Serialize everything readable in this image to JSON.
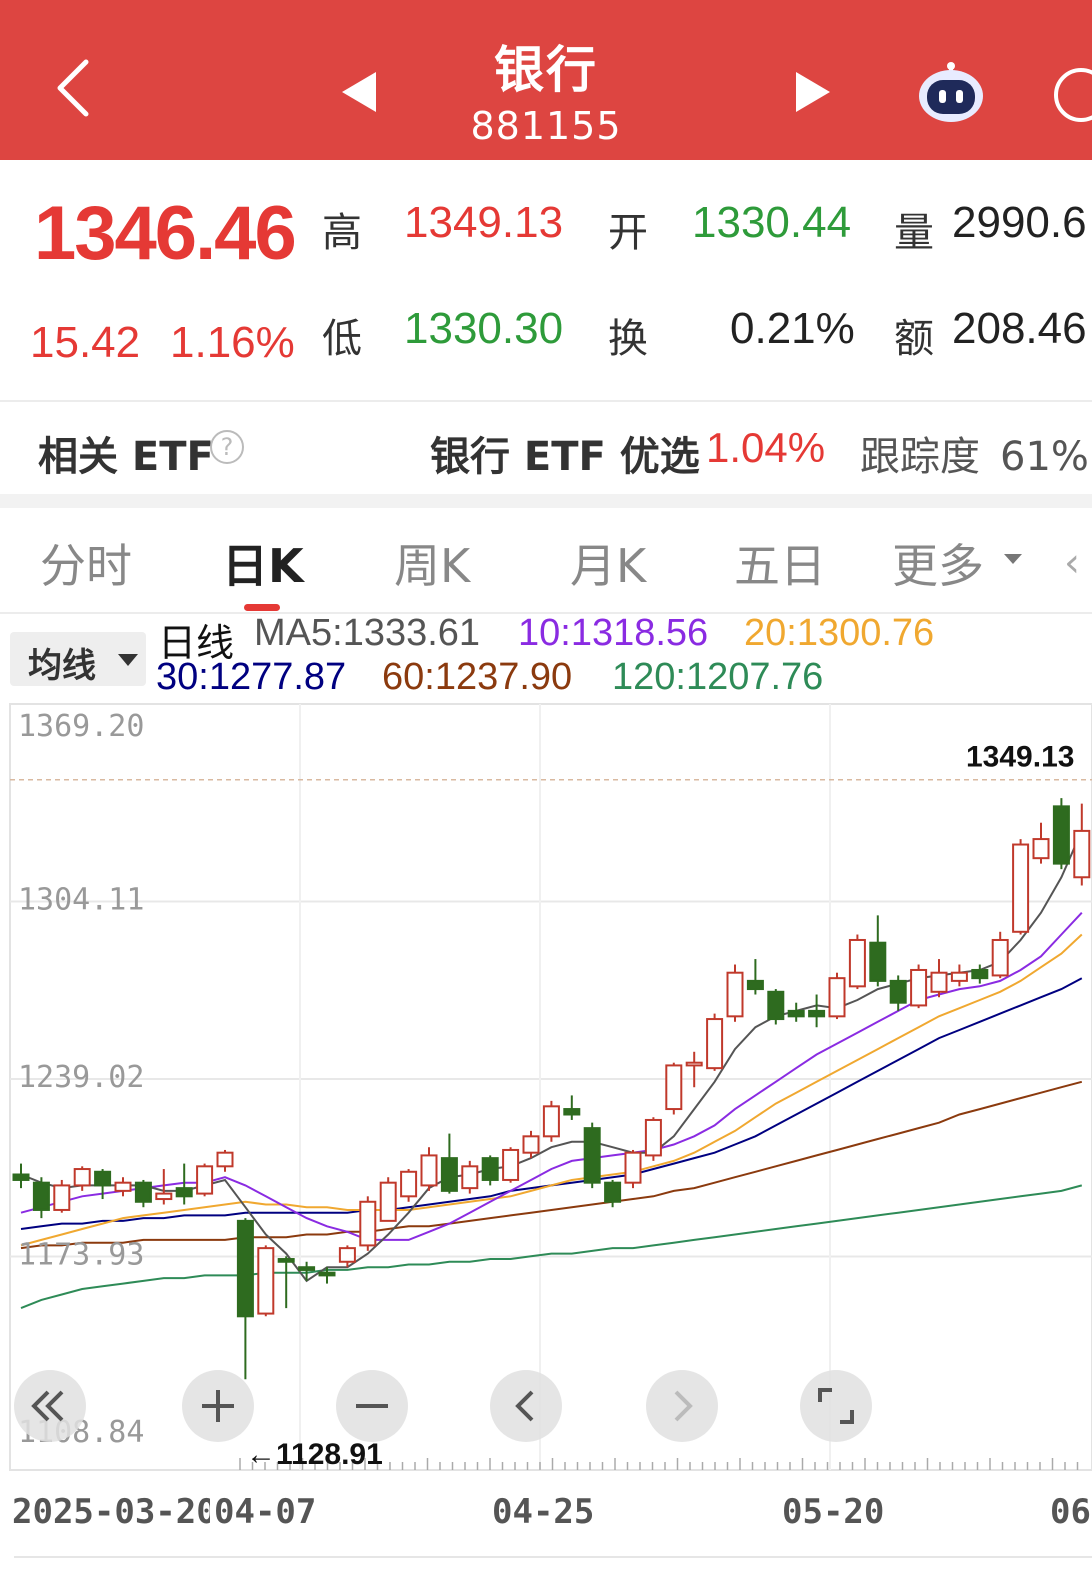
{
  "header": {
    "title": "银行",
    "code": "881155",
    "bg_color": "#dd4541"
  },
  "quote": {
    "price": "1346.46",
    "change": "15.42",
    "change_pct": "1.16%",
    "high_label": "高",
    "high": "1349.13",
    "open_label": "开",
    "open": "1330.44",
    "volume_label": "量",
    "volume": "2990.6",
    "low_label": "低",
    "low": "1330.30",
    "turnover_label": "换",
    "turnover": "0.21%",
    "amount_label": "额",
    "amount": "208.46"
  },
  "etf": {
    "label": "相关 ETF",
    "help_icon": "?",
    "name": "银行 ETF 优选",
    "pct": "1.04%",
    "track_label": "跟踪度",
    "track_value": "61%"
  },
  "tabs": [
    {
      "label": "分时"
    },
    {
      "label": "日K"
    },
    {
      "label": "周K"
    },
    {
      "label": "月K"
    },
    {
      "label": "五日"
    },
    {
      "label": "更多"
    }
  ],
  "ma_bar": {
    "button": "均线",
    "period": "日线",
    "ma5": "MA5:1333.61",
    "ma10": "10:1318.56",
    "ma20": "20:1300.76",
    "ma30": "30:1277.87",
    "ma60": "60:1237.90",
    "ma120": "120:1207.76",
    "colors": {
      "ma5": "#555555",
      "ma10": "#8a2be2",
      "ma20": "#f0a830",
      "ma30": "#000080",
      "ma60": "#8b3a0e",
      "ma120": "#2e8b57"
    }
  },
  "chart_data": {
    "type": "candlestick",
    "y_ticks": [
      "1369.20",
      "1304.11",
      "1239.02",
      "1173.93",
      "1108.84"
    ],
    "ylim": [
      1108.84,
      1369.2
    ],
    "x_labels": [
      "2025-03-20",
      "04-07",
      "04-25",
      "05-20",
      "06"
    ],
    "max_label": "1349.13",
    "min_label": "←1128.91",
    "up_color": "#c0392b",
    "down_color": "#2e6b1f",
    "candles": [
      {
        "o": 1204,
        "c": 1202,
        "h": 1208,
        "l": 1199
      },
      {
        "o": 1201,
        "c": 1191,
        "h": 1203,
        "l": 1188
      },
      {
        "o": 1191,
        "c": 1200,
        "h": 1202,
        "l": 1190
      },
      {
        "o": 1200,
        "c": 1206,
        "h": 1207,
        "l": 1198
      },
      {
        "o": 1205,
        "c": 1200,
        "h": 1206,
        "l": 1195
      },
      {
        "o": 1198,
        "c": 1201,
        "h": 1203,
        "l": 1196
      },
      {
        "o": 1201,
        "c": 1194,
        "h": 1202,
        "l": 1192
      },
      {
        "o": 1195,
        "c": 1197,
        "h": 1206,
        "l": 1193
      },
      {
        "o": 1199,
        "c": 1196,
        "h": 1208,
        "l": 1193
      },
      {
        "o": 1197,
        "c": 1207,
        "h": 1208,
        "l": 1196
      },
      {
        "o": 1207,
        "c": 1212,
        "h": 1213,
        "l": 1205
      },
      {
        "o": 1187,
        "c": 1152,
        "h": 1188,
        "l": 1128.91
      },
      {
        "o": 1153,
        "c": 1177,
        "h": 1178,
        "l": 1152
      },
      {
        "o": 1173,
        "c": 1172,
        "h": 1174,
        "l": 1155
      },
      {
        "o": 1170,
        "c": 1169,
        "h": 1172,
        "l": 1165
      },
      {
        "o": 1168,
        "c": 1167,
        "h": 1170,
        "l": 1164
      },
      {
        "o": 1172,
        "c": 1177,
        "h": 1178,
        "l": 1170
      },
      {
        "o": 1178,
        "c": 1194,
        "h": 1196,
        "l": 1176
      },
      {
        "o": 1187,
        "c": 1201,
        "h": 1203,
        "l": 1187
      },
      {
        "o": 1196,
        "c": 1205,
        "h": 1206,
        "l": 1194
      },
      {
        "o": 1200,
        "c": 1211,
        "h": 1214,
        "l": 1198
      },
      {
        "o": 1210,
        "c": 1198,
        "h": 1219,
        "l": 1197
      },
      {
        "o": 1199,
        "c": 1207,
        "h": 1209,
        "l": 1197
      },
      {
        "o": 1210,
        "c": 1202,
        "h": 1211,
        "l": 1200
      },
      {
        "o": 1202,
        "c": 1213,
        "h": 1214,
        "l": 1201
      },
      {
        "o": 1212,
        "c": 1218,
        "h": 1220,
        "l": 1210
      },
      {
        "o": 1218,
        "c": 1229,
        "h": 1231,
        "l": 1216
      },
      {
        "o": 1228,
        "c": 1226,
        "h": 1233,
        "l": 1224
      },
      {
        "o": 1221,
        "c": 1201,
        "h": 1223,
        "l": 1199
      },
      {
        "o": 1201,
        "c": 1194,
        "h": 1202,
        "l": 1192
      },
      {
        "o": 1201,
        "c": 1212,
        "h": 1213,
        "l": 1199
      },
      {
        "o": 1211,
        "c": 1224,
        "h": 1225,
        "l": 1209
      },
      {
        "o": 1228,
        "c": 1244,
        "h": 1245,
        "l": 1226
      },
      {
        "o": 1244,
        "c": 1245,
        "h": 1249,
        "l": 1236
      },
      {
        "o": 1243,
        "c": 1261,
        "h": 1263,
        "l": 1242
      },
      {
        "o": 1262,
        "c": 1278,
        "h": 1281,
        "l": 1260
      },
      {
        "o": 1275,
        "c": 1272,
        "h": 1283,
        "l": 1270
      },
      {
        "o": 1271,
        "c": 1261,
        "h": 1272,
        "l": 1259
      },
      {
        "o": 1264,
        "c": 1262,
        "h": 1267,
        "l": 1260
      },
      {
        "o": 1264,
        "c": 1262,
        "h": 1270,
        "l": 1258
      },
      {
        "o": 1262,
        "c": 1276,
        "h": 1278,
        "l": 1261
      },
      {
        "o": 1273,
        "c": 1290,
        "h": 1292,
        "l": 1272
      },
      {
        "o": 1289,
        "c": 1275,
        "h": 1299,
        "l": 1273
      },
      {
        "o": 1275,
        "c": 1267,
        "h": 1277,
        "l": 1264
      },
      {
        "o": 1266,
        "c": 1279,
        "h": 1281,
        "l": 1265
      },
      {
        "o": 1271,
        "c": 1278,
        "h": 1283,
        "l": 1269
      },
      {
        "o": 1275,
        "c": 1278,
        "h": 1281,
        "l": 1273
      },
      {
        "o": 1279,
        "c": 1276,
        "h": 1281,
        "l": 1274
      },
      {
        "o": 1277,
        "c": 1290,
        "h": 1293,
        "l": 1276
      },
      {
        "o": 1293,
        "c": 1325,
        "h": 1327,
        "l": 1292
      },
      {
        "o": 1320,
        "c": 1327,
        "h": 1333,
        "l": 1318
      },
      {
        "o": 1339,
        "c": 1318,
        "h": 1342,
        "l": 1316
      },
      {
        "o": 1313,
        "c": 1330,
        "h": 1340,
        "l": 1310
      }
    ],
    "ma5": [
      1204,
      1201,
      1199,
      1200,
      1200,
      1200,
      1200,
      1198,
      1198,
      1200,
      1202,
      1192,
      1182,
      1175,
      1165,
      1170,
      1170,
      1175,
      1182,
      1190,
      1199,
      1203,
      1204,
      1206,
      1207,
      1210,
      1214,
      1216,
      1216,
      1214,
      1212,
      1212,
      1218,
      1228,
      1238,
      1250,
      1258,
      1262,
      1264,
      1266,
      1265,
      1268,
      1272,
      1274,
      1276,
      1277,
      1278,
      1279,
      1282,
      1290,
      1300,
      1313,
      1330
    ],
    "ma10": [
      1190,
      1192,
      1194,
      1196,
      1197,
      1198,
      1199,
      1200,
      1201,
      1201,
      1203,
      1200,
      1196,
      1192,
      1188,
      1185,
      1183,
      1180,
      1180,
      1180,
      1183,
      1186,
      1190,
      1194,
      1198,
      1202,
      1206,
      1209,
      1210,
      1211,
      1212,
      1213,
      1215,
      1218,
      1222,
      1228,
      1233,
      1238,
      1243,
      1248,
      1252,
      1256,
      1260,
      1264,
      1268,
      1270,
      1272,
      1273,
      1275,
      1279,
      1284,
      1292,
      1300
    ],
    "ma20": [
      1178,
      1180,
      1182,
      1184,
      1186,
      1188,
      1189,
      1190,
      1191,
      1192,
      1193,
      1194,
      1193,
      1193,
      1192,
      1192,
      1191,
      1191,
      1191,
      1191,
      1192,
      1193,
      1194,
      1195,
      1196,
      1198,
      1200,
      1202,
      1203,
      1204,
      1205,
      1207,
      1209,
      1212,
      1216,
      1220,
      1225,
      1230,
      1234,
      1238,
      1242,
      1246,
      1250,
      1254,
      1258,
      1262,
      1265,
      1268,
      1271,
      1275,
      1280,
      1285,
      1292
    ],
    "ma30": [
      1184,
      1185,
      1186,
      1186,
      1187,
      1187,
      1188,
      1188,
      1189,
      1189,
      1189,
      1190,
      1190,
      1190,
      1190,
      1190,
      1190,
      1191,
      1191,
      1192,
      1193,
      1194,
      1195,
      1196,
      1198,
      1199,
      1200,
      1201,
      1202,
      1203,
      1204,
      1206,
      1208,
      1210,
      1212,
      1215,
      1218,
      1222,
      1226,
      1230,
      1234,
      1238,
      1242,
      1246,
      1250,
      1254,
      1257,
      1260,
      1263,
      1266,
      1269,
      1272,
      1276
    ],
    "ma60": [
      1177,
      1178,
      1178,
      1179,
      1179,
      1179,
      1180,
      1180,
      1180,
      1180,
      1180,
      1181,
      1181,
      1181,
      1182,
      1182,
      1183,
      1183,
      1184,
      1185,
      1185,
      1186,
      1187,
      1188,
      1189,
      1190,
      1191,
      1192,
      1193,
      1194,
      1195,
      1196,
      1198,
      1199,
      1201,
      1203,
      1205,
      1207,
      1209,
      1211,
      1213,
      1215,
      1217,
      1219,
      1221,
      1223,
      1226,
      1228,
      1230,
      1232,
      1234,
      1236,
      1238
    ],
    "ma120": [
      1155,
      1158,
      1160,
      1162,
      1163,
      1164,
      1165,
      1166,
      1166,
      1167,
      1167,
      1167,
      1168,
      1168,
      1168,
      1169,
      1169,
      1170,
      1170,
      1171,
      1171,
      1172,
      1172,
      1173,
      1173,
      1174,
      1175,
      1175,
      1176,
      1177,
      1177,
      1178,
      1179,
      1180,
      1181,
      1182,
      1183,
      1184,
      1185,
      1186,
      1187,
      1188,
      1189,
      1190,
      1191,
      1192,
      1193,
      1194,
      1195,
      1196,
      1197,
      1198,
      1200
    ]
  },
  "controls": {
    "rewind_icon": "double-chevron-left-icon",
    "zoom_in_icon": "plus-icon",
    "zoom_out_icon": "minus-icon",
    "prev_icon": "chevron-left-icon",
    "next_icon": "chevron-right-icon",
    "fullscreen_icon": "fullscreen-icon"
  }
}
